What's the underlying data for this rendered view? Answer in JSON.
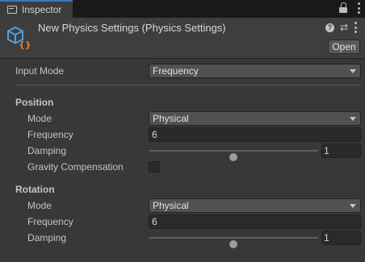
{
  "tab": {
    "label": "Inspector"
  },
  "header": {
    "title": "New Physics Settings (Physics Settings)",
    "open_label": "Open"
  },
  "input_mode": {
    "label": "Input Mode",
    "value": "Frequency"
  },
  "position": {
    "section_label": "Position",
    "mode": {
      "label": "Mode",
      "value": "Physical"
    },
    "frequency": {
      "label": "Frequency",
      "value": "6"
    },
    "damping": {
      "label": "Damping",
      "value": "1",
      "slider_fraction": 0.5
    },
    "gravity": {
      "label": "Gravity Compensation",
      "checked": false
    }
  },
  "rotation": {
    "section_label": "Rotation",
    "mode": {
      "label": "Mode",
      "value": "Physical"
    },
    "frequency": {
      "label": "Frequency",
      "value": "6"
    },
    "damping": {
      "label": "Damping",
      "value": "1",
      "slider_fraction": 0.5
    }
  },
  "colors": {
    "accent": "#3a79bb",
    "asset_icon_blue": "#4aa3df",
    "asset_icon_orange": "#f07a3c"
  }
}
